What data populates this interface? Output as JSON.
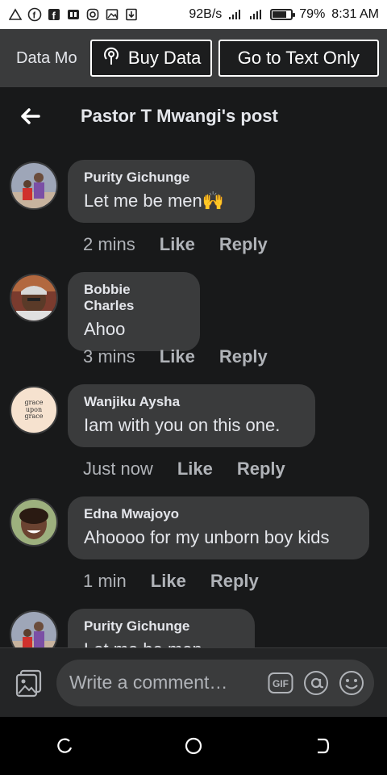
{
  "status_bar": {
    "network_speed": "92B/s",
    "battery_percent": "79%",
    "time": "8:31 AM",
    "battery_level": 0.79
  },
  "data_bar": {
    "label": "Data Mo",
    "buy_data": "Buy Data",
    "text_only": "Go to Text Only"
  },
  "header": {
    "title": "Pastor T Mwangi's post"
  },
  "comments": [
    {
      "name": "Purity Gichunge",
      "text": "Let me be men🙌",
      "time": "2 mins",
      "like": "Like",
      "reply": "Reply"
    },
    {
      "name": "Bobbie Charles",
      "text": "Ahoo",
      "time": "3 mins",
      "like": "Like",
      "reply": "Reply"
    },
    {
      "name": "Wanjiku Aysha",
      "text": "Iam with you on this one.",
      "time": "Just now",
      "like": "Like",
      "reply": "Reply",
      "avatar_text": "grace upon grace"
    },
    {
      "name": "Edna Mwajoyo",
      "text": "Ahoooo for my unborn boy kids",
      "time": "1 min",
      "like": "Like",
      "reply": "Reply"
    },
    {
      "name": "Purity Gichunge",
      "text": "Let me be men",
      "time": "",
      "like": "",
      "reply": ""
    }
  ],
  "composer": {
    "placeholder": "Write a comment…",
    "gif_label": "GIF"
  },
  "colors": {
    "background": "#18191a",
    "bubble": "#3a3b3c",
    "text": "#e4e6eb",
    "secondary_text": "#b0b3b8"
  }
}
